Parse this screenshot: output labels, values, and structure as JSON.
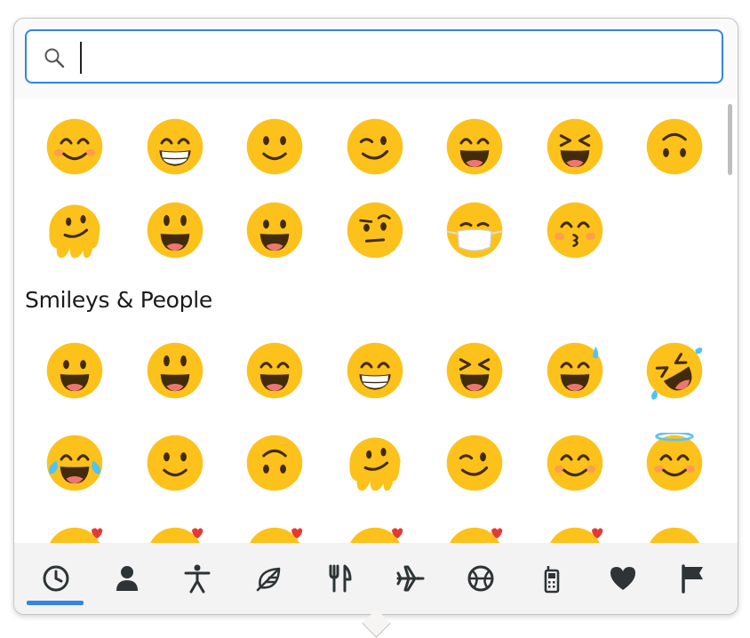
{
  "search": {
    "placeholder": "",
    "value": ""
  },
  "recent": {
    "emojis": [
      "😊",
      "😁",
      "🙂",
      "😉",
      "😄",
      "😆",
      "🙃",
      "🫠",
      "😃",
      "😀",
      "🤨",
      "😷",
      "😚"
    ]
  },
  "sections": [
    {
      "title": "Smileys & People",
      "emojis": [
        "😀",
        "😃",
        "😄",
        "😁",
        "😆",
        "😅",
        "🤣",
        "😂",
        "🙂",
        "🙃",
        "🫠",
        "😉",
        "😊",
        "😇",
        "🥰",
        "😍",
        "🤩",
        "😘",
        "😗",
        "☺️",
        "😚"
      ]
    }
  ],
  "tabs": [
    {
      "name": "recent",
      "icon": "clock-icon",
      "selected": true
    },
    {
      "name": "people",
      "icon": "person-icon",
      "selected": false
    },
    {
      "name": "body",
      "icon": "accessibility-icon",
      "selected": false
    },
    {
      "name": "nature",
      "icon": "leaf-icon",
      "selected": false
    },
    {
      "name": "food",
      "icon": "fork-knife-icon",
      "selected": false
    },
    {
      "name": "travel",
      "icon": "airplane-icon",
      "selected": false
    },
    {
      "name": "activities",
      "icon": "ball-icon",
      "selected": false
    },
    {
      "name": "objects",
      "icon": "phone-icon",
      "selected": false
    },
    {
      "name": "symbols",
      "icon": "heart-icon",
      "selected": false
    },
    {
      "name": "flags",
      "icon": "flag-icon",
      "selected": false
    }
  ],
  "colors": {
    "accent": "#3584e4",
    "face": "#fcc21b",
    "face_dark": "#e59600",
    "mouth": "#422b0d",
    "tongue": "#ed7770",
    "blush": "#ff7f7f",
    "icon": "#2e3436"
  }
}
